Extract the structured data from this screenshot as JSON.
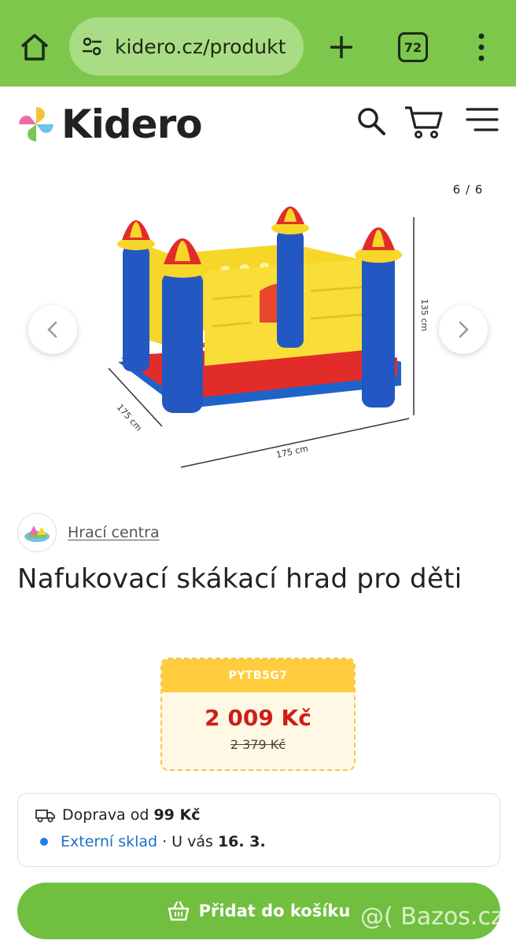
{
  "browser": {
    "url": "kidero.cz/produkt",
    "tab_count": "72"
  },
  "header": {
    "logo_text": "Kidero"
  },
  "gallery": {
    "counter": "6 / 6",
    "dimension_height": "135 cm",
    "dimension_depth": "175 cm",
    "dimension_width": "175 cm"
  },
  "product": {
    "category": "Hrací centra",
    "title": "Nafukovací skákací hrad pro děti",
    "code": "PYTB5G7",
    "price": "2 009 Kč",
    "old_price": "2 379 Kč"
  },
  "info": {
    "shipping_prefix": "Doprava od",
    "shipping_price": "99 Kč",
    "stock_label": "Externí sklad",
    "delivery_prefix": "U vás",
    "delivery_date": "16. 3."
  },
  "actions": {
    "add_to_cart": "Přidat do košíku"
  },
  "watermark": "@( Bazos.cz",
  "colors": {
    "browser_bar": "#7dc74c",
    "accent_green": "#71bf3f",
    "price_red": "#cc1f1a",
    "code_yellow": "#ffcc3d",
    "link_blue": "#1f6fc7"
  }
}
